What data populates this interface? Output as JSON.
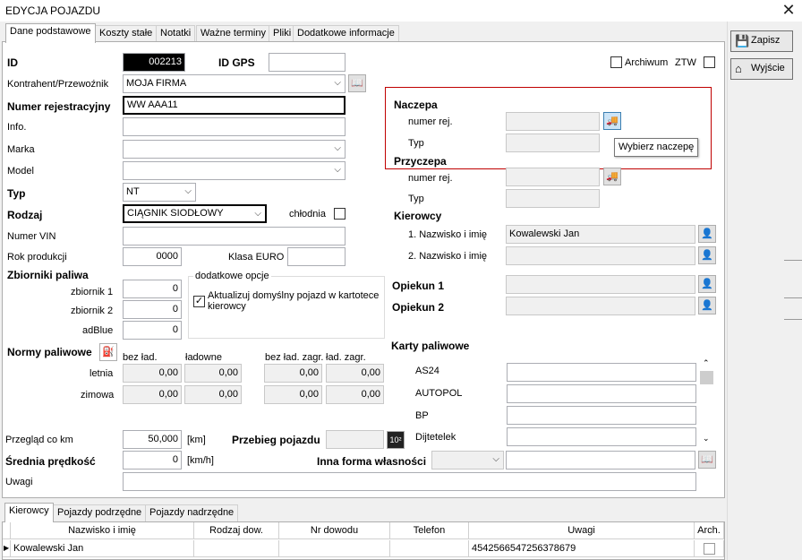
{
  "window": {
    "title": "EDYCJA POJAZDU",
    "close_glyph": "✕"
  },
  "tabs": [
    "Dane podstawowe",
    "Koszty stałe",
    "Notatki",
    "Ważne terminy",
    "Pliki",
    "Dodatkowe informacje"
  ],
  "side_buttons": {
    "save": "Zapisz",
    "exit": "Wyjście"
  },
  "form": {
    "id_label": "ID",
    "id_value": "002213",
    "gps_label": "ID GPS",
    "gps_value": "",
    "archive_label": "Archiwum",
    "ztw_label": "ZTW",
    "contractor_label": "Kontrahent/Przewoźnik",
    "contractor_value": "MOJA FIRMA",
    "reg_label": "Numer rejestracyjny",
    "reg_value": "WW AAA11",
    "info_label": "Info.",
    "brand_label": "Marka",
    "model_label": "Model",
    "type_label": "Typ",
    "type_value": "NT",
    "kind_label": "Rodzaj",
    "kind_value": "CIĄGNIK SIODŁOWY",
    "cold_label": "chłodnia",
    "vin_label": "Numer VIN",
    "year_label": "Rok produkcji",
    "year_value": "0000",
    "euro_label": "Klasa EURO",
    "tanks_label": "Zbiorniki paliwa",
    "tank1_label": "zbiornik 1",
    "tank1_value": "0",
    "tank2_label": "zbiornik 2",
    "tank2_value": "0",
    "adblue_label": "adBlue",
    "adblue_value": "0",
    "options_label": "dodatkowe opcje",
    "update_default_label": "Aktualizuj domyślny pojazd w kartotece kierowcy",
    "fuel_norms_label": "Normy paliwowe",
    "norm_cols": [
      "bez ład.",
      "ładowne",
      "bez ład. zagr.",
      "ład. zagr."
    ],
    "summer_label": "letnia",
    "summer_values": [
      "0,00",
      "0,00",
      "0,00",
      "0,00"
    ],
    "winter_label": "zimowa",
    "winter_values": [
      "0,00",
      "0,00",
      "0,00",
      "0,00"
    ],
    "inspection_label": "Przegląd co km",
    "inspection_value": "50,000",
    "km_unit": "[km]",
    "mileage_label": "Przebieg pojazdu",
    "avg_speed_label": "Średnia prędkość",
    "avg_speed_value": "0",
    "kmh_unit": "[km/h]",
    "ownership_label": "Inna forma własności",
    "notes_label": "Uwagi"
  },
  "trailer": {
    "title": "Naczepa",
    "reg_label": "numer rej.",
    "type_label": "Typ",
    "tooltip": "Wybierz naczepę"
  },
  "semitrailer": {
    "title": "Przyczepa",
    "reg_label": "numer rej.",
    "type_label": "Typ"
  },
  "drivers": {
    "title": "Kierowcy",
    "d1_label": "1. Nazwisko i imię",
    "d1_value": "Kowalewski Jan",
    "d2_label": "2. Nazwisko i imię",
    "d2_value": ""
  },
  "guardians": {
    "g1_label": "Opiekun 1",
    "g2_label": "Opiekun 2"
  },
  "fuel_cards": {
    "title": "Karty paliwowe",
    "items": [
      "AS24",
      "AUTOPOL",
      "BP",
      "Dijtetelek"
    ]
  },
  "bottom_tabs": [
    "Kierowcy",
    "Pojazdy podrzędne",
    "Pojazdy nadrzędne"
  ],
  "grid": {
    "headers": [
      "Nazwisko i imię",
      "Rodzaj dow.",
      "Nr dowodu",
      "Telefon",
      "Uwagi",
      "Arch."
    ],
    "row": [
      "Kowalewski Jan",
      "",
      "",
      "",
      "4542566547256378679",
      ""
    ]
  },
  "colors": {
    "highlight_border": "#c00000",
    "id_bg": "#000000"
  }
}
